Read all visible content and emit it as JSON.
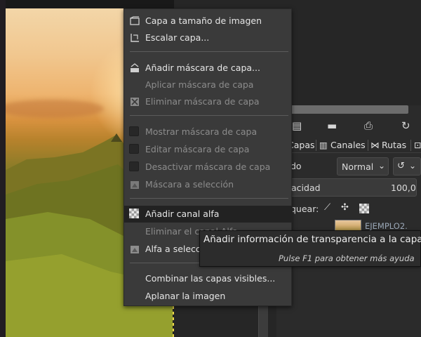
{
  "menu": {
    "items": [
      {
        "label": "Capa a tamaño de imagen",
        "icon": "layer-to-image-size-icon",
        "enabled": true
      },
      {
        "label": "Escalar capa...",
        "icon": "scale-layer-icon",
        "enabled": true
      },
      {
        "label": "Añadir máscara de capa...",
        "icon": "add-layer-mask-icon",
        "enabled": true
      },
      {
        "label": "Aplicar máscara de capa",
        "icon": "",
        "enabled": false
      },
      {
        "label": "Eliminar máscara de capa",
        "icon": "delete-mask-icon",
        "enabled": false
      },
      {
        "label": "Mostrar máscara de capa",
        "icon": "checkbox-icon",
        "enabled": false
      },
      {
        "label": "Editar máscara de capa",
        "icon": "checkbox-icon",
        "enabled": false
      },
      {
        "label": "Desactivar máscara de capa",
        "icon": "checkbox-icon",
        "enabled": false
      },
      {
        "label": "Máscara a selección",
        "icon": "mask-to-selection-icon",
        "enabled": false
      },
      {
        "label": "Añadir canal alfa",
        "icon": "checker-alpha-icon",
        "enabled": true,
        "highlighted": true
      },
      {
        "label": "Eliminar el canal Alfa",
        "icon": "",
        "enabled": false
      },
      {
        "label": "Alfa a selección",
        "icon": "alpha-to-selection-icon",
        "enabled": true
      },
      {
        "label": "Combinar las capas visibles...",
        "icon": "",
        "enabled": true
      },
      {
        "label": "Aplanar la imagen",
        "icon": "",
        "enabled": true
      }
    ]
  },
  "tooltip": {
    "title": "Añadir información de transparencia a la capa",
    "hint": "Pulse F1 para obtener más ayuda"
  },
  "dock": {
    "tabs": [
      "Capas",
      "Canales",
      "Rutas"
    ],
    "mode_label": "do",
    "mode_value": "Normal",
    "opacity_label": "acidad",
    "opacity_value": "100,0",
    "lock_label": "quear:",
    "layer_name": "EJEMPLO2."
  }
}
